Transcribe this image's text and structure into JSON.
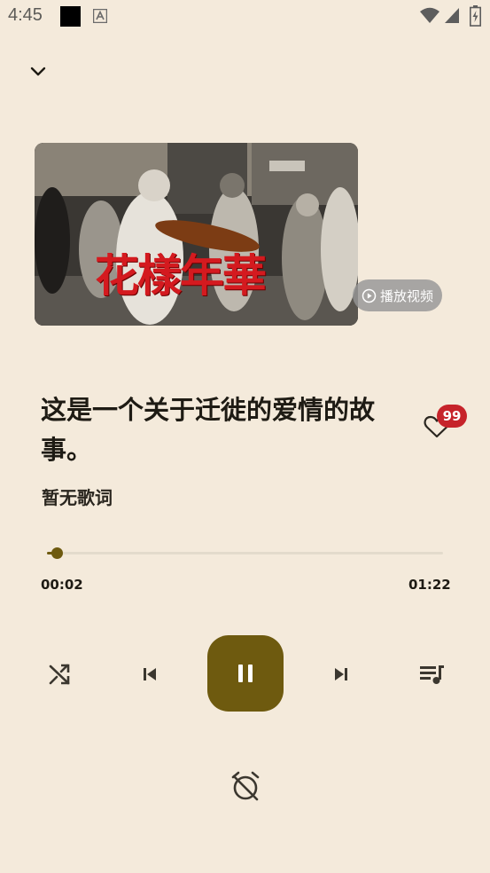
{
  "status_bar": {
    "time": "4:45"
  },
  "cover": {
    "overlay_text": "花樣年華",
    "play_video_label": "播放视频"
  },
  "song": {
    "title": "这是一个关于迁徙的爱情的故事。",
    "lyrics_placeholder": "暂无歌词"
  },
  "like": {
    "count": "99"
  },
  "progress": {
    "current": "00:02",
    "total": "01:22",
    "fraction": 0.024
  },
  "colors": {
    "background": "#f4eadb",
    "accent": "#6e5a0f",
    "badge": "#c6232a"
  },
  "icons": [
    "chevron-down-icon",
    "shuffle-icon",
    "previous-icon",
    "pause-icon",
    "next-icon",
    "playlist-icon",
    "heart-icon",
    "alarm-off-icon",
    "play-circle-icon"
  ]
}
